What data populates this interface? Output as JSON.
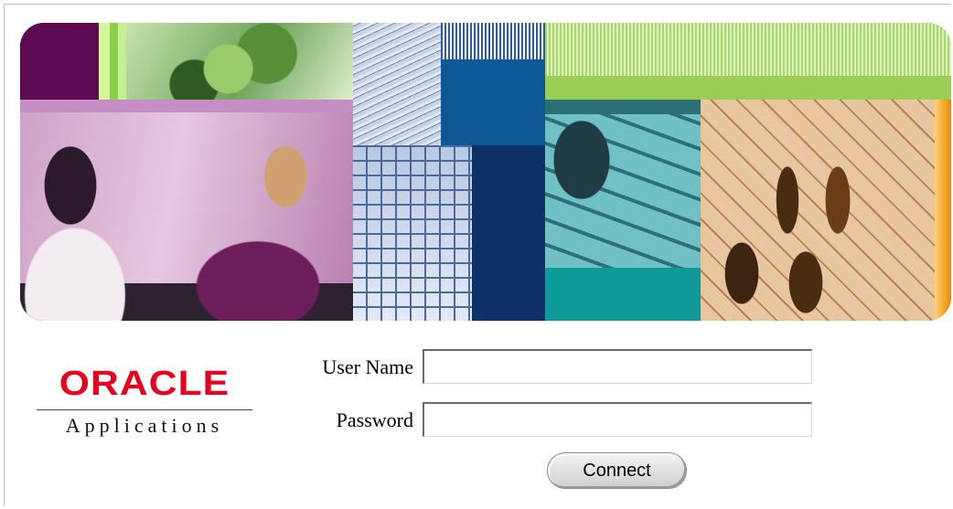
{
  "branding": {
    "logo_word": "ORACLE",
    "logo_subtitle": "Applications",
    "logo_color": "#e8001e"
  },
  "login": {
    "username_label": "User Name",
    "username_value": "",
    "password_label": "Password",
    "password_value": "",
    "connect_label": "Connect"
  }
}
